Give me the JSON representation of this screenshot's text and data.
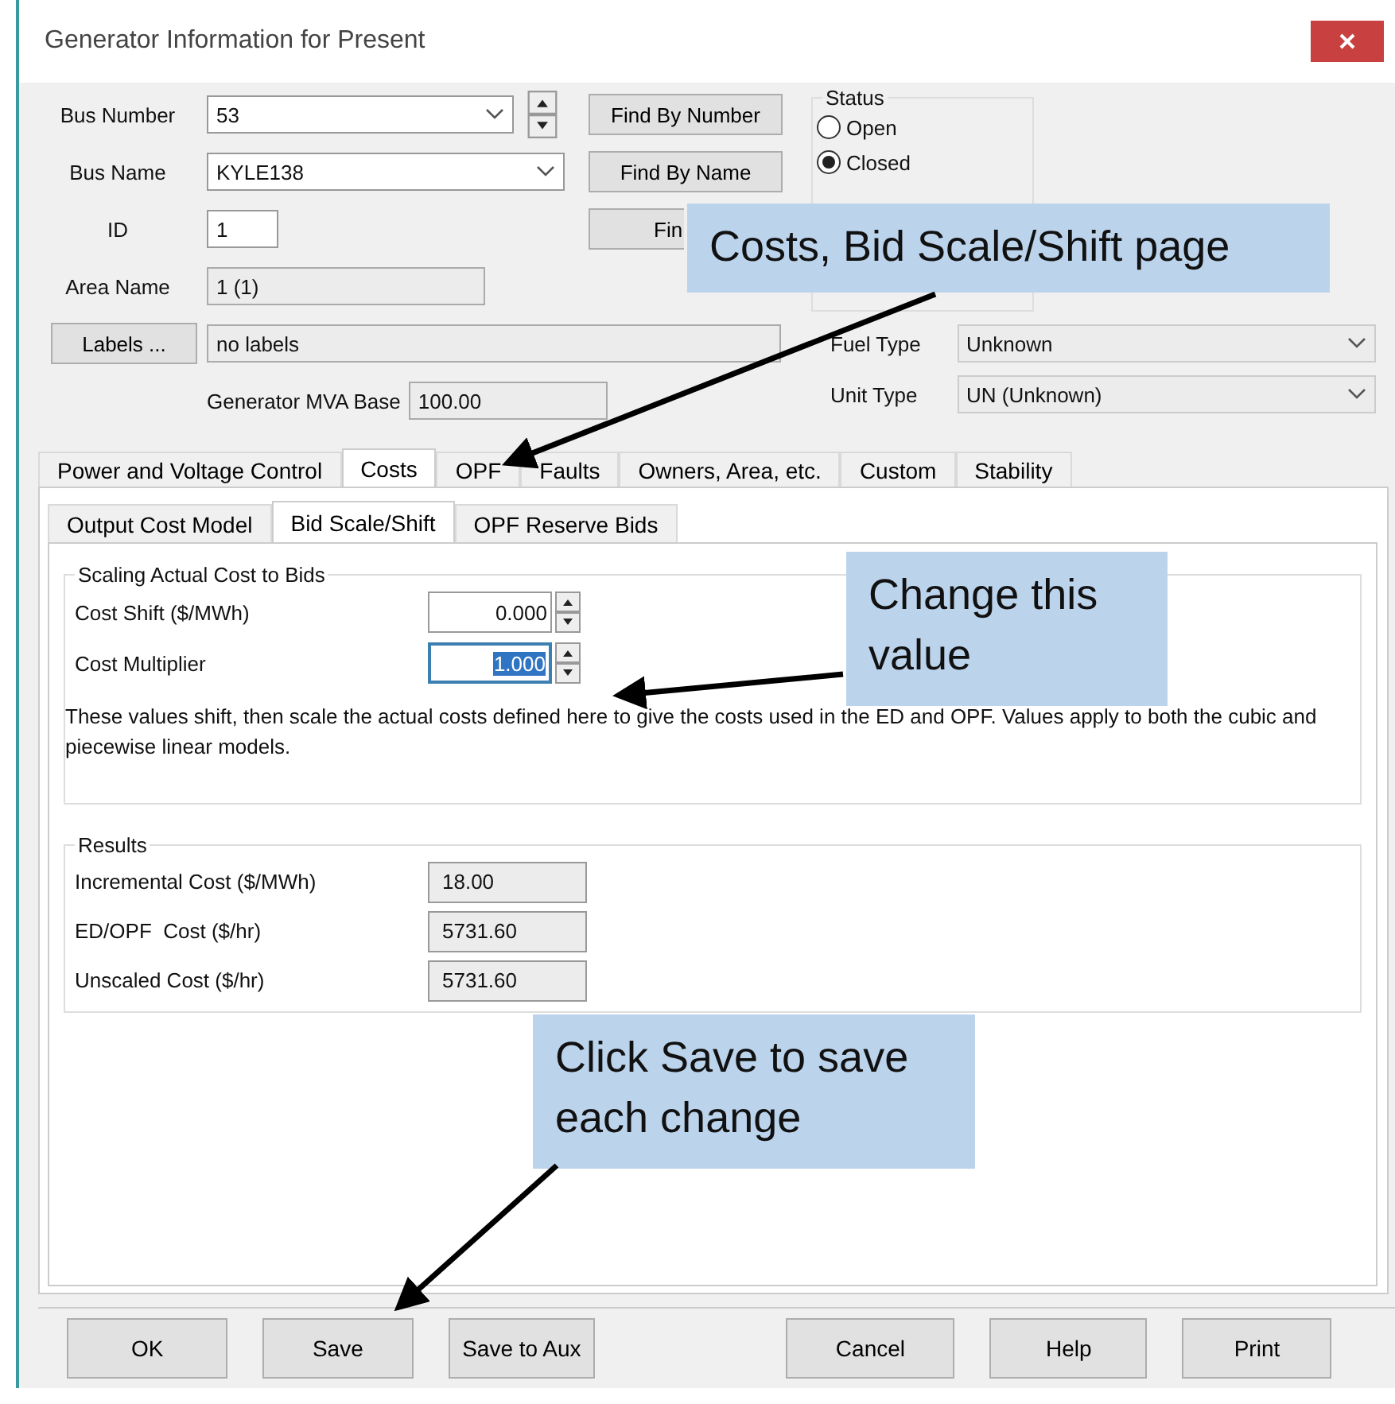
{
  "window": {
    "title": "Generator Information for Present"
  },
  "form": {
    "bus_number": {
      "label": "Bus Number",
      "value": "53",
      "button": "Find By Number"
    },
    "bus_name": {
      "label": "Bus Name",
      "value": "KYLE138",
      "button": "Find By Name"
    },
    "id": {
      "label": "ID",
      "value": "1",
      "button": "Fin"
    },
    "area_name": {
      "label": "Area Name",
      "value": "1 (1)"
    },
    "labels": {
      "button": "Labels ...",
      "value": "no labels"
    },
    "mva_base": {
      "label": "Generator MVA Base",
      "value": "100.00"
    }
  },
  "status": {
    "title": "Status",
    "options": [
      {
        "label": "Open",
        "selected": false
      },
      {
        "label": "Closed",
        "selected": true
      }
    ]
  },
  "fuel_type": {
    "label": "Fuel Type",
    "value": "Unknown"
  },
  "unit_type": {
    "label": "Unit Type",
    "value": "UN (Unknown)"
  },
  "tabs": [
    {
      "label": "Power and Voltage Control",
      "selected": false
    },
    {
      "label": "Costs",
      "selected": true
    },
    {
      "label": "OPF",
      "selected": false
    },
    {
      "label": "Faults",
      "selected": false
    },
    {
      "label": "Owners, Area, etc.",
      "selected": false
    },
    {
      "label": "Custom",
      "selected": false
    },
    {
      "label": "Stability",
      "selected": false
    }
  ],
  "subtabs": [
    {
      "label": "Output Cost Model",
      "selected": false
    },
    {
      "label": "Bid Scale/Shift",
      "selected": true
    },
    {
      "label": "OPF Reserve Bids",
      "selected": false
    }
  ],
  "scaling": {
    "title": "Scaling Actual Cost to Bids",
    "fields": [
      {
        "label": "Cost Shift ($/MWh)",
        "value": "0.000",
        "focused": false
      },
      {
        "label": "Cost Multiplier",
        "value": "1.000",
        "focused": true
      }
    ],
    "note": "These values shift, then scale the actual costs defined here to give the costs used in the ED and OPF. Values apply to both the cubic and piecewise linear models."
  },
  "results": {
    "title": "Results",
    "fields": [
      {
        "label": "Incremental Cost ($/MWh)",
        "value": "18.00"
      },
      {
        "label": "ED/OPF  Cost ($/hr)",
        "value": "5731.60"
      },
      {
        "label": "Unscaled Cost ($/hr)",
        "value": "5731.60"
      }
    ]
  },
  "buttons": [
    {
      "label": "OK"
    },
    {
      "label": "Save"
    },
    {
      "label": "Save to Aux"
    },
    {
      "label": "Cancel"
    },
    {
      "label": "Help"
    },
    {
      "label": "Print"
    }
  ],
  "callouts": [
    {
      "text": "Costs, Bid Scale/Shift page"
    },
    {
      "text": "Change this value"
    },
    {
      "text": "Click Save to save each change"
    }
  ]
}
